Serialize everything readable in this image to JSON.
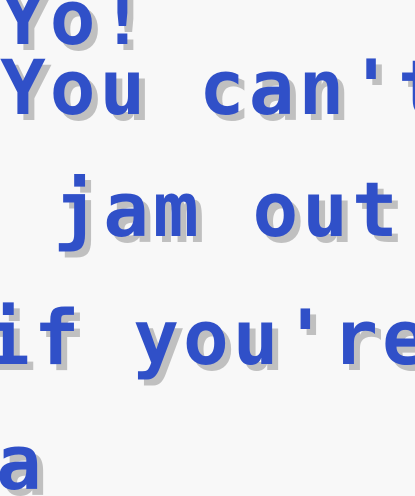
{
  "colors": {
    "background": "#f8f8f8",
    "text": "#3050c8",
    "text_shadow": "#c0c0c0"
  },
  "dialogue": {
    "lines": [
      "Yo!",
      "You can't",
      "  jam out i",
      "if you're ",
      "a"
    ]
  }
}
